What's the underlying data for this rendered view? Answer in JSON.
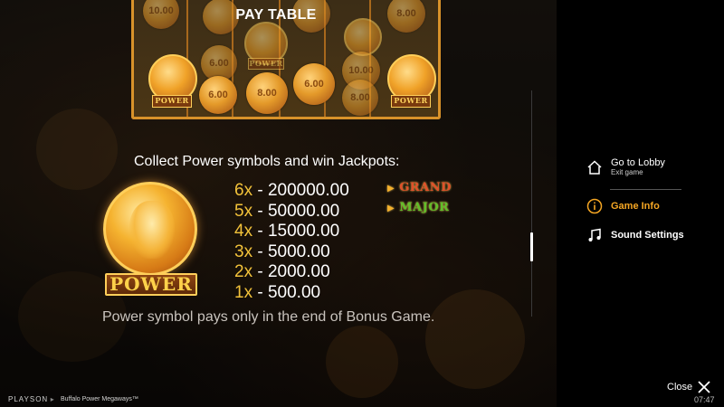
{
  "panel": {
    "title": "PAY TABLE"
  },
  "reels": {
    "coin_values": [
      "8.00",
      "6.00",
      "8.00",
      "6.00",
      "10.00",
      "8.00",
      "8.00",
      "6.00",
      "10.00"
    ],
    "power_label": "POWER"
  },
  "jackpot_section": {
    "heading": "Collect Power symbols and win Jackpots:",
    "symbol_label": "POWER",
    "payouts": [
      {
        "multiplier": "6x",
        "value": "200000.00"
      },
      {
        "multiplier": "5x",
        "value": "50000.00"
      },
      {
        "multiplier": "4x",
        "value": "15000.00"
      },
      {
        "multiplier": "3x",
        "value": "5000.00"
      },
      {
        "multiplier": "2x",
        "value": "2000.00"
      },
      {
        "multiplier": "1x",
        "value": "500.00"
      }
    ],
    "jackpots": [
      {
        "label": "GRAND",
        "color": "#e0502a"
      },
      {
        "label": "MAJOR",
        "color": "#5fbf2a"
      }
    ],
    "note": "Power symbol pays only in the end of Bonus Game."
  },
  "side_menu": {
    "lobby": {
      "label": "Go to Lobby",
      "sublabel": "Exit game",
      "icon": "home-icon"
    },
    "game_info": {
      "label": "Game Info",
      "icon": "info-icon",
      "color": "#f5a623"
    },
    "sound": {
      "label": "Sound Settings",
      "icon": "music-note-icon"
    },
    "close_label": "Close",
    "time": "07:47"
  },
  "footer": {
    "brand": "PLAYSON",
    "game_name": "Buffalo Power Megaways™"
  }
}
